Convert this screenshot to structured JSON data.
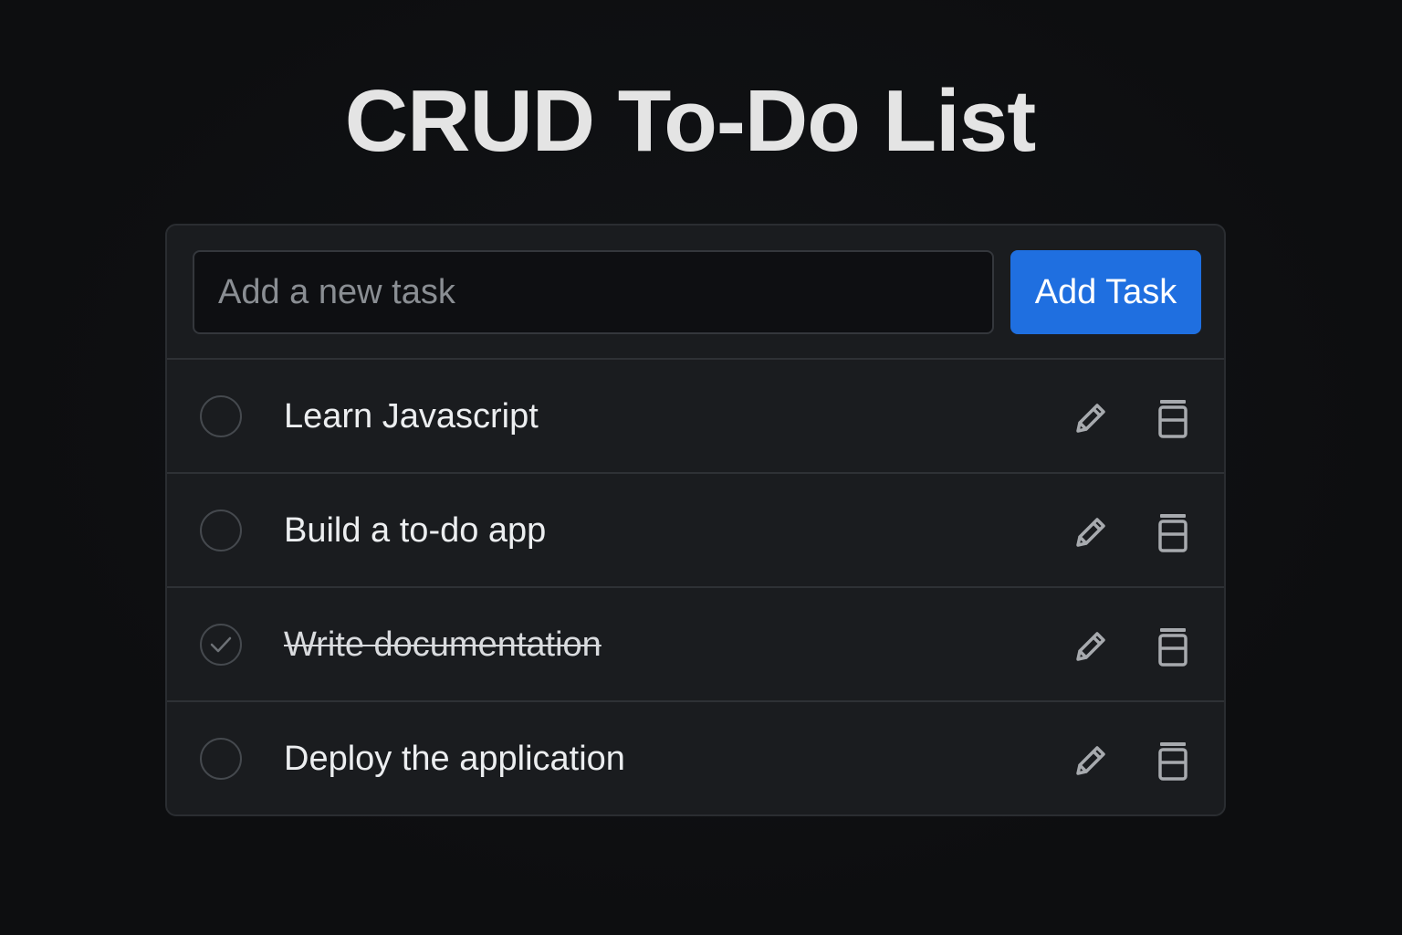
{
  "title": "CRUD To-Do List",
  "new_task": {
    "placeholder": "Add a new task",
    "value": "",
    "add_button_label": "Add Task"
  },
  "tasks": [
    {
      "text": "Learn Javascript",
      "completed": false
    },
    {
      "text": "Build a to-do app",
      "completed": false
    },
    {
      "text": "Write documentation",
      "completed": true
    },
    {
      "text": "Deploy the application",
      "completed": false
    }
  ],
  "icons": {
    "edit": "pencil-icon",
    "delete": "trash-icon",
    "complete": "checkmark-icon"
  },
  "colors": {
    "background": "#0e0f11",
    "card": "#1a1c1f",
    "accent": "#1f6fe0",
    "text": "#eceef0",
    "icon": "#a7aaae"
  }
}
